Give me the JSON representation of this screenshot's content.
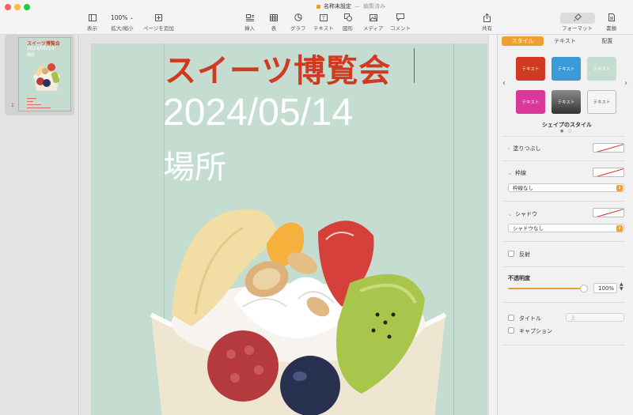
{
  "window": {
    "doc_name": "名称未設定",
    "separator": "—",
    "doc_status": "編集済み"
  },
  "toolbar": {
    "view_label": "表示",
    "zoom_value": "100%",
    "zoom_label": "拡大/縮小",
    "add_page_label": "ページを追加",
    "insert_label": "挿入",
    "table_label": "表",
    "chart_label": "グラフ",
    "text_label": "テキスト",
    "shape_label": "図形",
    "media_label": "メディア",
    "comment_label": "コメント",
    "share_label": "共有",
    "format_label": "フォーマット",
    "document_label": "書類"
  },
  "thumbnail": {
    "page_number": "1",
    "title": "スイーツ博覧会",
    "date": "2024/05/14",
    "place": "場所"
  },
  "page": {
    "title": "スイーツ博覧会",
    "date": "2024/05/14",
    "place": "場所"
  },
  "inspector": {
    "tabs": [
      "スタイル",
      "テキスト",
      "配置"
    ],
    "active_tab": "スタイル",
    "style_presets": [
      {
        "label": "テキスト",
        "bg": "#d03a22",
        "fg": "#ffffff"
      },
      {
        "label": "テキスト",
        "bg": "#3d9ad8",
        "fg": "#ffffff"
      },
      {
        "label": "テキスト",
        "bg": "#c5ddd0",
        "fg": "#ffffff"
      },
      {
        "label": "テキスト",
        "bg": "#d9389a",
        "fg": "#ffffff"
      },
      {
        "label": "テキスト",
        "bg": "#5a5a5a",
        "fg": "#ffffff"
      },
      {
        "label": "テキスト",
        "bg": "#f4f4f4",
        "fg": "#555555"
      }
    ],
    "shape_styles_label": "シェイプのスタイル",
    "fill_label": "塗りつぶし",
    "border_label": "枠線",
    "border_value": "枠線なし",
    "shadow_label": "シャドウ",
    "shadow_value": "シャドウなし",
    "reflection_label": "反射",
    "opacity_label": "不透明度",
    "opacity_value": "100%",
    "opacity_fraction": 1.0,
    "title_label": "タイトル",
    "title_position": "上",
    "caption_label": "キャプション"
  },
  "colors": {
    "accent": "#f0a030",
    "title_red": "#d13a22",
    "page_bg": "#c5ddd0"
  }
}
